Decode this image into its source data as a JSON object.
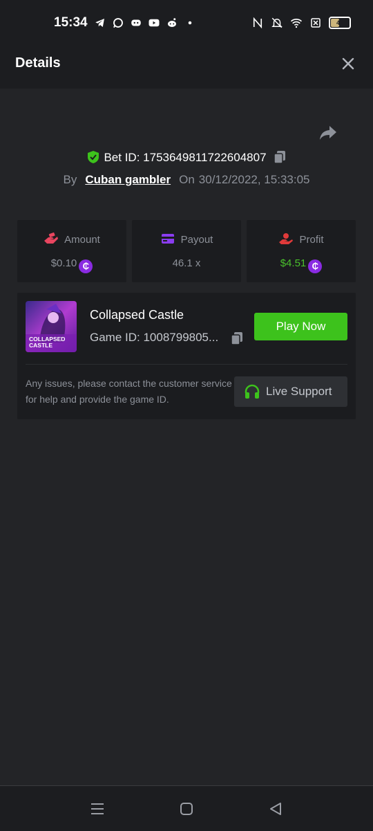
{
  "status_bar": {
    "time": "15:34",
    "battery_level": "46",
    "left_icons": [
      "telegram-icon",
      "whatsapp-icon",
      "discord-icon",
      "youtube-icon",
      "reddit-icon",
      "dot-icon"
    ],
    "right_icons": [
      "nfc-icon",
      "bell-off-icon",
      "wifi-icon",
      "sim-off-icon",
      "battery-icon"
    ]
  },
  "header": {
    "title": "Details",
    "close_icon": "close-icon"
  },
  "bet": {
    "id_label": "Bet ID: 1753649811722604807",
    "by_label": "By",
    "user": "Cuban gambler",
    "on_label": "On",
    "date": "30/12/2022, 15:33:05"
  },
  "stats": {
    "amount": {
      "label": "Amount",
      "value": "$0.10",
      "icon": "hand-money-icon",
      "icon_color": "#e8455f"
    },
    "payout": {
      "label": "Payout",
      "value": "46.1 x",
      "icon": "card-icon",
      "icon_color": "#8a3cf0"
    },
    "profit": {
      "label": "Profit",
      "value": "$4.51",
      "icon": "profit-hand-icon",
      "icon_color": "#e03a3a"
    },
    "currency_symbol": "₵"
  },
  "game": {
    "name": "Collapsed Castle",
    "id_label": "Game ID: 1008799805...",
    "thumb_text_1": "COLLAPSED",
    "thumb_text_2": "CASTLE",
    "play_label": "Play Now",
    "help_text": "Any issues, please contact the customer service for help and provide the game ID.",
    "live_support_label": "Live Support"
  },
  "colors": {
    "accent_green": "#3dc21c",
    "profit_green": "#4ac02c",
    "coin_purple": "#8a2be2",
    "background": "#232427",
    "card": "#1b1c1f"
  }
}
